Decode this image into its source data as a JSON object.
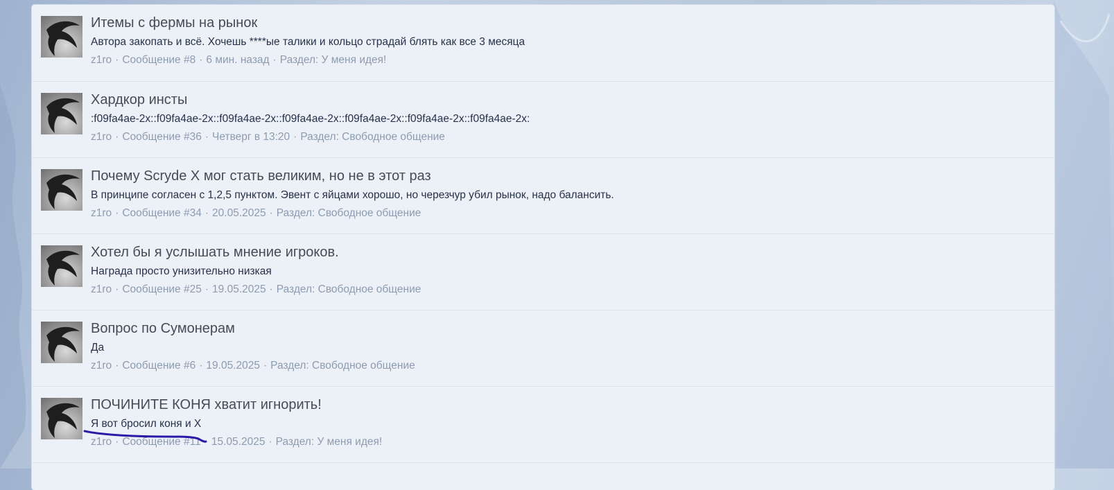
{
  "results": [
    {
      "title": "Итемы с фермы на рынок",
      "snippet": "Автора закопать и всё. Хочешь ****ые талики и кольцо страдай блять как все 3 месяца",
      "author": "z1ro",
      "post": "Сообщение #8",
      "date": "6 мин. назад",
      "section": "Раздел: У меня идея!"
    },
    {
      "title": "Хардкор инсты",
      "snippet": ":f09fa4ae-2x::f09fa4ae-2x::f09fa4ae-2x::f09fa4ae-2x::f09fa4ae-2x::f09fa4ae-2x::f09fa4ae-2x:",
      "author": "z1ro",
      "post": "Сообщение #36",
      "date": "Четверг в 13:20",
      "section": "Раздел: Свободное общение"
    },
    {
      "title": "Почему Scryde X мог стать великим, но не в этот раз",
      "snippet": "В принципе согласен с 1,2,5 пунктом. Эвент с яйцами хорошо, но черезчур убил рынок, надо балансить.",
      "author": "z1ro",
      "post": "Сообщение #34",
      "date": "20.05.2025",
      "section": "Раздел: Свободное общение"
    },
    {
      "title": "Хотел бы я услышать мнение игроков.",
      "snippet": "Награда просто унизительно низкая",
      "author": "z1ro",
      "post": "Сообщение #25",
      "date": "19.05.2025",
      "section": "Раздел: Свободное общение"
    },
    {
      "title": "Вопрос по Сумонерам",
      "snippet": "Да",
      "author": "z1ro",
      "post": "Сообщение #6",
      "date": "19.05.2025",
      "section": "Раздел: Свободное общение"
    },
    {
      "title": "ПОЧИНИТЕ КОНЯ хватит игнорить!",
      "snippet": "Я вот бросил коня и Х",
      "author": "z1ro",
      "post": "Сообщение #11",
      "date": "15.05.2025",
      "section": "Раздел: У меня идея!"
    }
  ],
  "separator": "·",
  "annotation_color": "#2a1aa8"
}
